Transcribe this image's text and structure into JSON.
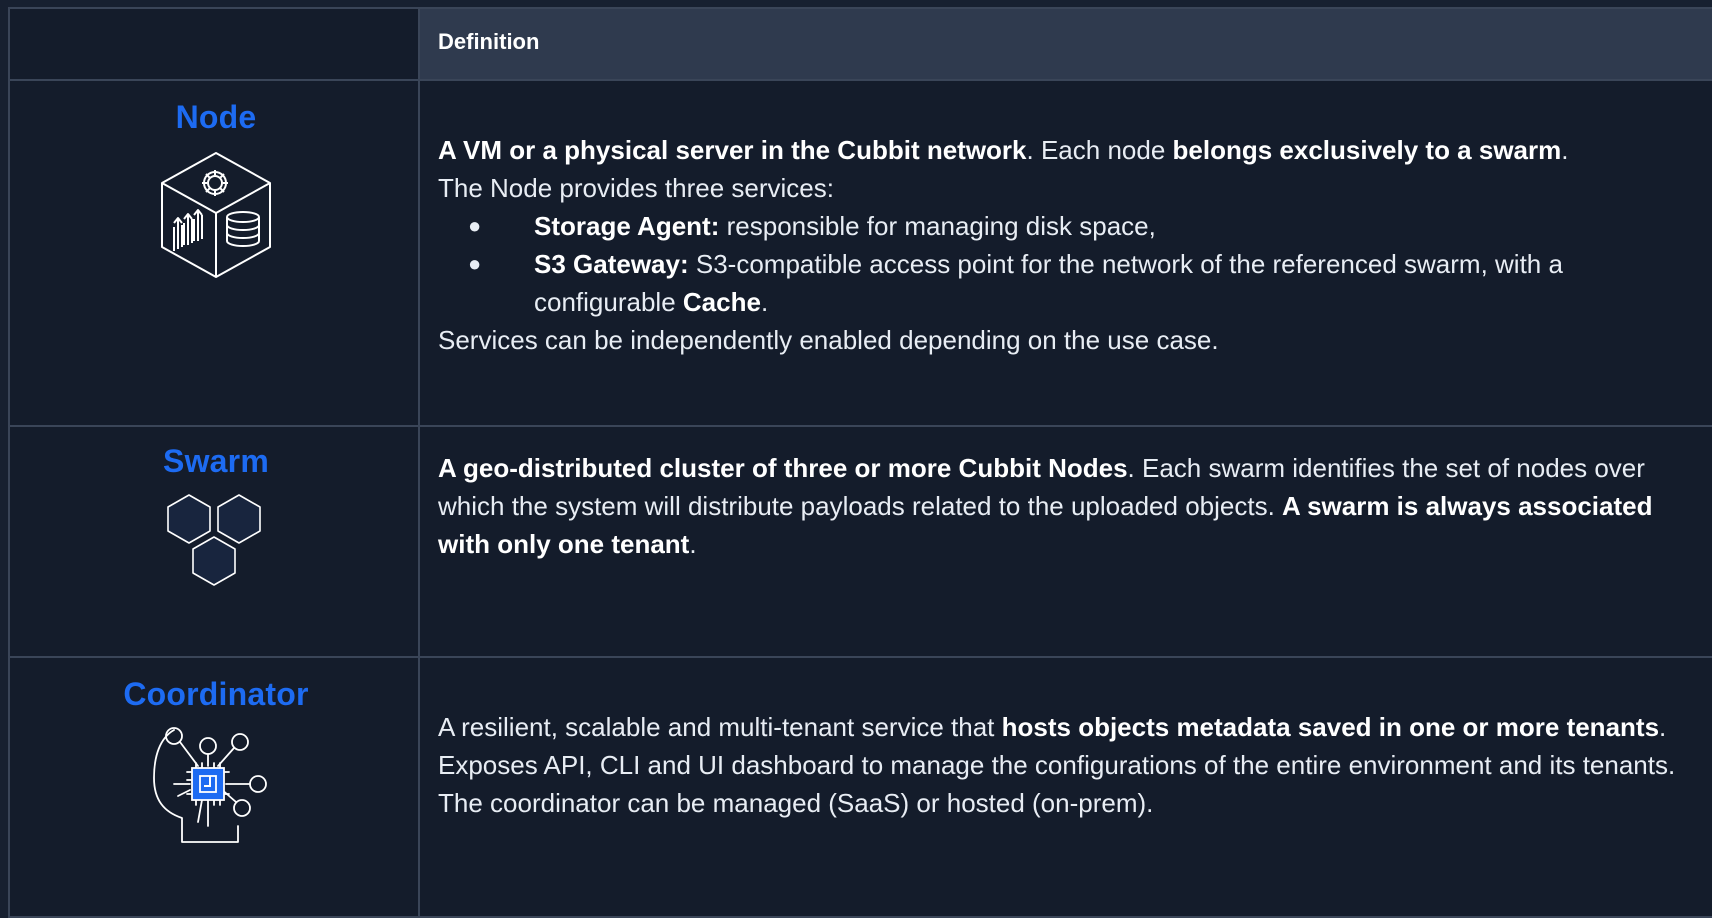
{
  "header": {
    "term_label": "",
    "definition_label": "Definition"
  },
  "rows": [
    {
      "title": "Node",
      "icon": "node-cube-icon",
      "p1": [
        {
          "t": "A VM or a physical server in the Cubbit network",
          "b": true
        },
        {
          "t": ". Each node ",
          "b": false
        },
        {
          "t": "belongs exclusively to a swarm",
          "b": true
        },
        {
          "t": ".",
          "b": false
        }
      ],
      "p2": "The Node provides three services:",
      "bullets": [
        [
          {
            "t": "Storage Agent:",
            "b": true
          },
          {
            "t": " responsible for managing disk space,",
            "b": false
          }
        ],
        [
          {
            "t": "S3 Gateway:",
            "b": true
          },
          {
            "t": " S3-compatible access point for the network of the referenced swarm, with a configurable ",
            "b": false
          },
          {
            "t": "Cache",
            "b": true
          },
          {
            "t": ".",
            "b": false
          }
        ]
      ],
      "p3": "Services can be independently enabled depending on the use case."
    },
    {
      "title": "Swarm",
      "icon": "swarm-hexagons-icon",
      "p1": [
        {
          "t": "A geo-distributed cluster of three or more Cubbit Nodes",
          "b": true
        },
        {
          "t": ". Each swarm identifies the set of nodes over which the system will distribute payloads related to the uploaded objects. ",
          "b": false
        },
        {
          "t": "A swarm is always associated with only one tenant",
          "b": true
        },
        {
          "t": ".",
          "b": false
        }
      ]
    },
    {
      "title": "Coordinator",
      "icon": "coordinator-chip-head-icon",
      "p1": [
        {
          "t": "A resilient, scalable and multi-tenant service that ",
          "b": false
        },
        {
          "t": "hosts objects metadata saved in one or more tenants",
          "b": true
        },
        {
          "t": ". Exposes API, CLI and UI dashboard to manage the configurations of the entire environment and its tenants. The coordinator can be managed (SaaS) or hosted (on-prem).",
          "b": false
        }
      ]
    }
  ],
  "bullet_glyph": "●",
  "colors": {
    "accent": "#1d6bf2",
    "background": "#141c2b",
    "header_bg": "#2f3a4e",
    "border": "#3a4558"
  }
}
